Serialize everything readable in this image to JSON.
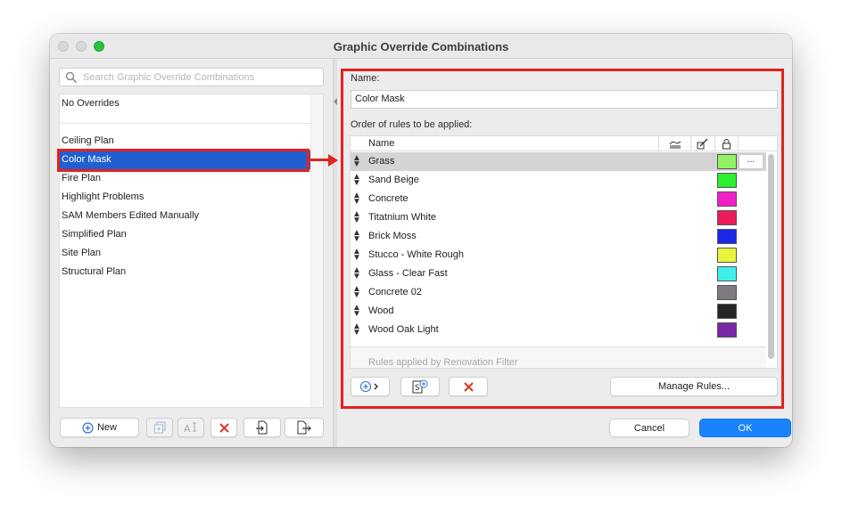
{
  "window": {
    "title": "Graphic Override Combinations"
  },
  "search": {
    "placeholder": "Search Graphic Override Combinations",
    "value": ""
  },
  "combinations": {
    "top_item": "No Overrides",
    "items": [
      {
        "label": "Ceiling Plan",
        "selected": false
      },
      {
        "label": "Color Mask",
        "selected": true
      },
      {
        "label": "Fire Plan",
        "selected": false
      },
      {
        "label": "Highlight Problems",
        "selected": false
      },
      {
        "label": "SAM Members Edited Manually",
        "selected": false
      },
      {
        "label": "Simplified Plan",
        "selected": false
      },
      {
        "label": "Site Plan",
        "selected": false
      },
      {
        "label": "Structural Plan",
        "selected": false
      }
    ]
  },
  "left_toolbar": {
    "new_label": "New",
    "icons": [
      "plus-circle-icon",
      "duplicate-icon",
      "rename-icon",
      "delete-icon",
      "import-icon",
      "export-icon"
    ]
  },
  "editor": {
    "name_label": "Name:",
    "name_value": "Color Mask",
    "rules_label": "Order of rules to be applied:",
    "table_header": {
      "name": "Name",
      "icons": [
        "fill-icon",
        "pen-icon",
        "lock-icon"
      ]
    },
    "rules": [
      {
        "name": "Grass",
        "color": "#93f263",
        "selected": true,
        "more": "..."
      },
      {
        "name": "Sand Beige",
        "color": "#2cef31",
        "selected": false
      },
      {
        "name": "Concrete",
        "color": "#f21fc9",
        "selected": false
      },
      {
        "name": "Titatnium White",
        "color": "#ec1b5a",
        "selected": false
      },
      {
        "name": "Brick Moss",
        "color": "#1a29e8",
        "selected": false
      },
      {
        "name": "Stucco - White Rough",
        "color": "#e8f53b",
        "selected": false
      },
      {
        "name": "Glass - Clear Fast",
        "color": "#3ff0ea",
        "selected": false
      },
      {
        "name": "Concrete 02",
        "color": "#7d7a80",
        "selected": false
      },
      {
        "name": "Wood",
        "color": "#252525",
        "selected": false
      },
      {
        "name": "Wood Oak Light",
        "color": "#7b27a8",
        "selected": false
      }
    ],
    "renovation_label": "Rules applied by Renovation Filter",
    "manage_rules_label": "Manage Rules...",
    "toolbar_icons": [
      "add-rule-icon",
      "add-from-icon",
      "delete-rule-icon"
    ]
  },
  "dialog_buttons": {
    "cancel": "Cancel",
    "ok": "OK"
  },
  "colors": {
    "accent": "#1a82fb",
    "selection": "#1f5fd0",
    "annotation": "#e5211d"
  }
}
